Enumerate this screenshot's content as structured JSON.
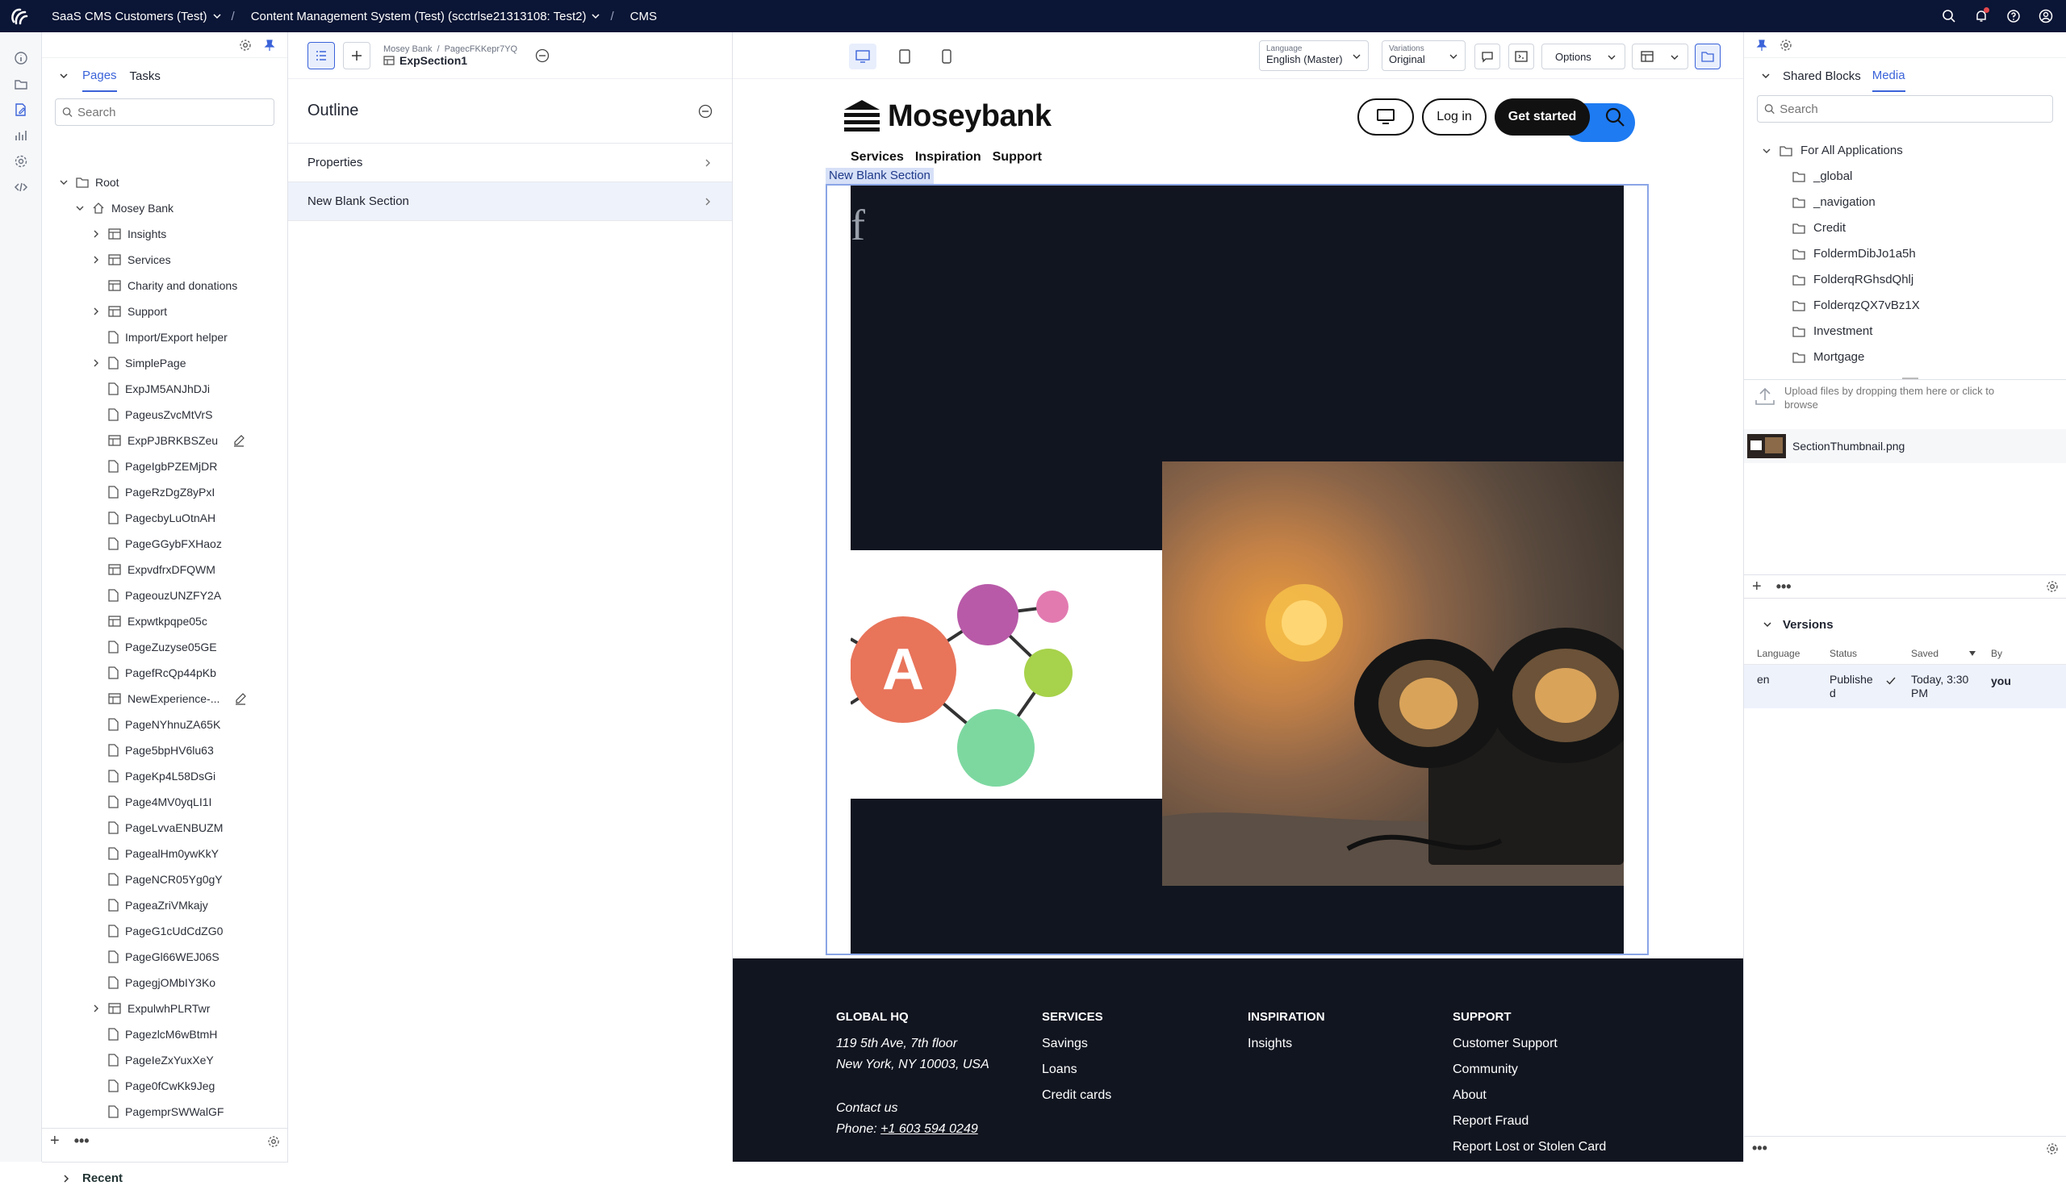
{
  "topbar": {
    "crumb1": "SaaS CMS Customers (Test)",
    "crumb2": "Content Management System (Test) (scctrlse21313108: Test2)",
    "crumb3": "CMS"
  },
  "tree": {
    "tabs": [
      "Pages",
      "Tasks"
    ],
    "search_placeholder": "Search",
    "items": [
      {
        "label": "Root"
      },
      {
        "label": "Mosey Bank"
      },
      {
        "label": "Insights"
      },
      {
        "label": "Services"
      },
      {
        "label": "Charity and donations"
      },
      {
        "label": "Support"
      },
      {
        "label": "Import/Export helper"
      },
      {
        "label": "SimplePage"
      },
      {
        "label": "ExpJM5ANJhDJi"
      },
      {
        "label": "PageusZvcMtVrS"
      },
      {
        "label": "ExpPJBRKBSZeu"
      },
      {
        "label": "PageIgbPZEMjDR"
      },
      {
        "label": "PageRzDgZ8yPxI"
      },
      {
        "label": "PagecbyLuOtnAH"
      },
      {
        "label": "PageGGybFXHaoz"
      },
      {
        "label": "ExpvdfrxDFQWM"
      },
      {
        "label": "PageouzUNZFY2A"
      },
      {
        "label": "Expwtkpqpe05c"
      },
      {
        "label": "PageZuzyse05GE"
      },
      {
        "label": "PagefRcQp44pKb"
      },
      {
        "label": "NewExperience-..."
      },
      {
        "label": "PageNYhnuZA65K"
      },
      {
        "label": "Page5bpHV6lu63"
      },
      {
        "label": "PageKp4L58DsGi"
      },
      {
        "label": "Page4MV0yqLI1I"
      },
      {
        "label": "PageLvvaENBUZM"
      },
      {
        "label": "PagealHm0ywKkY"
      },
      {
        "label": "PageNCR05Yg0gY"
      },
      {
        "label": "PageaZriVMkajy"
      },
      {
        "label": "PageG1cUdCdZG0"
      },
      {
        "label": "PageGl66WEJ06S"
      },
      {
        "label": "PagegjOMbIY3Ko"
      },
      {
        "label": "ExpulwhPLRTwr"
      },
      {
        "label": "PagezlcM6wBtmH"
      },
      {
        "label": "PageIeZxYuxXeY"
      },
      {
        "label": "Page0fCwKk9Jeg"
      },
      {
        "label": "PagemprSWWalGF"
      }
    ],
    "recent": "Recent"
  },
  "editor": {
    "crumb_parent": "Mosey Bank",
    "crumb_sep": "/",
    "crumb_page": "PagecFKKepr7YQ",
    "item_name": "ExpSection1",
    "outline_title": "Outline",
    "outline_items": [
      "Properties",
      "New Blank Section"
    ],
    "language_label": "Language",
    "language_value": "English (Master)",
    "variations_label": "Variations",
    "variations_value": "Original",
    "options": "Options"
  },
  "preview": {
    "brand": "Moseybank",
    "nav": [
      "Services",
      "Inspiration",
      "Support"
    ],
    "login": "Log in",
    "get_started": "Get started",
    "section_label": "New Blank Section",
    "stray_char": "f",
    "footer": {
      "hq_title": "GLOBAL HQ",
      "hq_line1": "119 5th Ave, 7th floor",
      "hq_line2": "New York, NY 10003, USA",
      "contact": "Contact us",
      "phone_label": "Phone:",
      "phone": "+1 603 594 0249",
      "services_title": "SERVICES",
      "services": [
        "Savings",
        "Loans",
        "Credit cards"
      ],
      "inspiration_title": "INSPIRATION",
      "inspiration": [
        "Insights"
      ],
      "support_title": "SUPPORT",
      "support": [
        "Customer Support",
        "Community",
        "About",
        "Report Fraud",
        "Report Lost or Stolen Card"
      ]
    }
  },
  "right": {
    "tabs": [
      "Shared Blocks",
      "Media"
    ],
    "search_placeholder": "Search",
    "root_folder": "For All Applications",
    "folders": [
      "_global",
      "_navigation",
      "Credit",
      "FoldermDibJo1a5h",
      "FolderqRGhsdQhlj",
      "FolderqzQX7vBz1X",
      "Investment",
      "Mortgage"
    ],
    "upload_text": "Upload files by dropping them here or click to browse",
    "file_name": "SectionThumbnail.png",
    "versions_title": "Versions",
    "versions_headers": [
      "Language",
      "Status",
      "Saved",
      "By"
    ],
    "version_row": {
      "language": "en",
      "status": "Publishe d",
      "saved": "Today, 3:30 PM",
      "by": "you"
    }
  },
  "colors": {
    "topbar": "#0b1535",
    "accent": "#3b63d9",
    "preview_dark": "#111520"
  }
}
